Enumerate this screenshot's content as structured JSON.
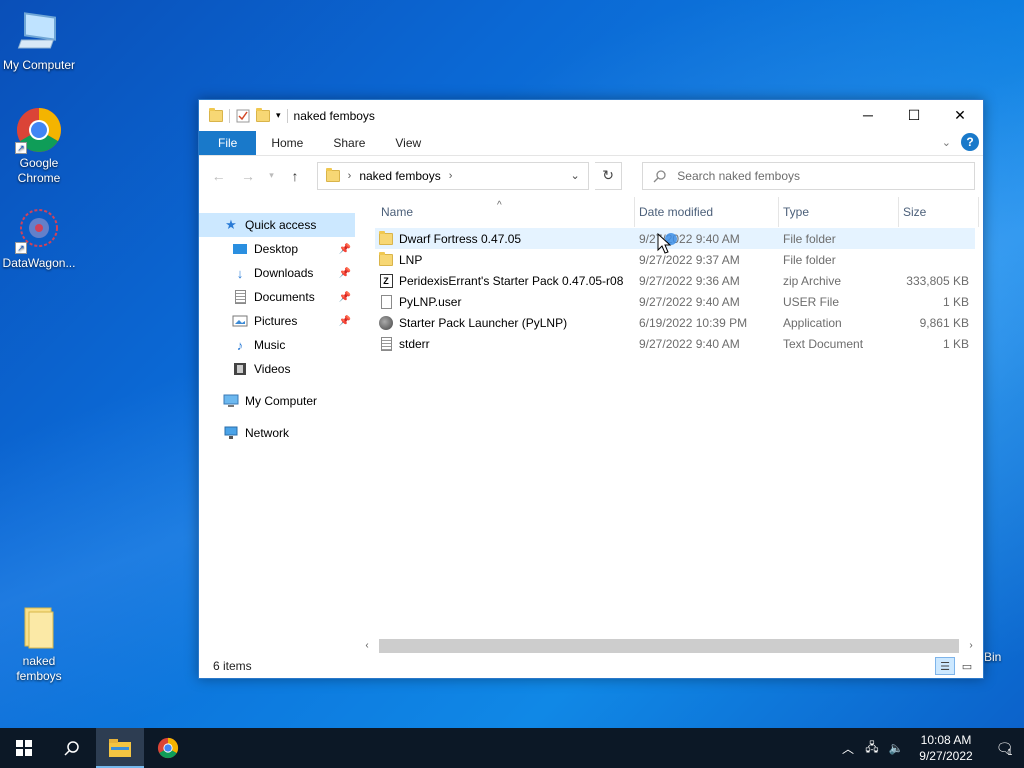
{
  "desktop": {
    "icons": [
      {
        "label": "My Computer"
      },
      {
        "label": "Google Chrome"
      },
      {
        "label": "DataWagon..."
      },
      {
        "label": "naked femboys"
      }
    ],
    "recycle_bin_partial_label": "Bin"
  },
  "window": {
    "title": "naked femboys",
    "ribbon_tabs": [
      "File",
      "Home",
      "Share",
      "View"
    ],
    "address": {
      "crumb": "naked femboys"
    },
    "search": {
      "placeholder": "Search naked femboys"
    },
    "nav_pane": {
      "quick_access": "Quick access",
      "pinned": [
        "Desktop",
        "Downloads",
        "Documents",
        "Pictures"
      ],
      "unpinned": [
        "Music",
        "Videos"
      ],
      "my_computer": "My Computer",
      "network": "Network"
    },
    "columns": [
      "Name",
      "Date modified",
      "Type",
      "Size"
    ],
    "files": [
      {
        "name": "Dwarf Fortress 0.47.05",
        "date": "9/27/2022 9:40 AM",
        "type": "File folder",
        "size": "",
        "icon": "folder-icon"
      },
      {
        "name": "LNP",
        "date": "9/27/2022 9:37 AM",
        "type": "File folder",
        "size": "",
        "icon": "folder-icon"
      },
      {
        "name": "PeridexisErrant's Starter Pack 0.47.05-r08",
        "date": "9/27/2022 9:36 AM",
        "type": "zip Archive",
        "size": "333,805 KB",
        "icon": "zip-icon"
      },
      {
        "name": "PyLNP.user",
        "date": "9/27/2022 9:40 AM",
        "type": "USER File",
        "size": "1 KB",
        "icon": "file-icon"
      },
      {
        "name": "Starter Pack Launcher (PyLNP)",
        "date": "6/19/2022 10:39 PM",
        "type": "Application",
        "size": "9,861 KB",
        "icon": "app-icon"
      },
      {
        "name": "stderr",
        "date": "9/27/2022 9:40 AM",
        "type": "Text Document",
        "size": "1 KB",
        "icon": "text-doc-icon"
      }
    ],
    "status": "6 items"
  },
  "taskbar": {
    "clock_time": "10:08 AM",
    "clock_date": "9/27/2022",
    "notification_count": "1"
  },
  "colors": {
    "accent": "#1979ca",
    "selection": "#cce8ff",
    "taskbar": "#0c1826"
  }
}
